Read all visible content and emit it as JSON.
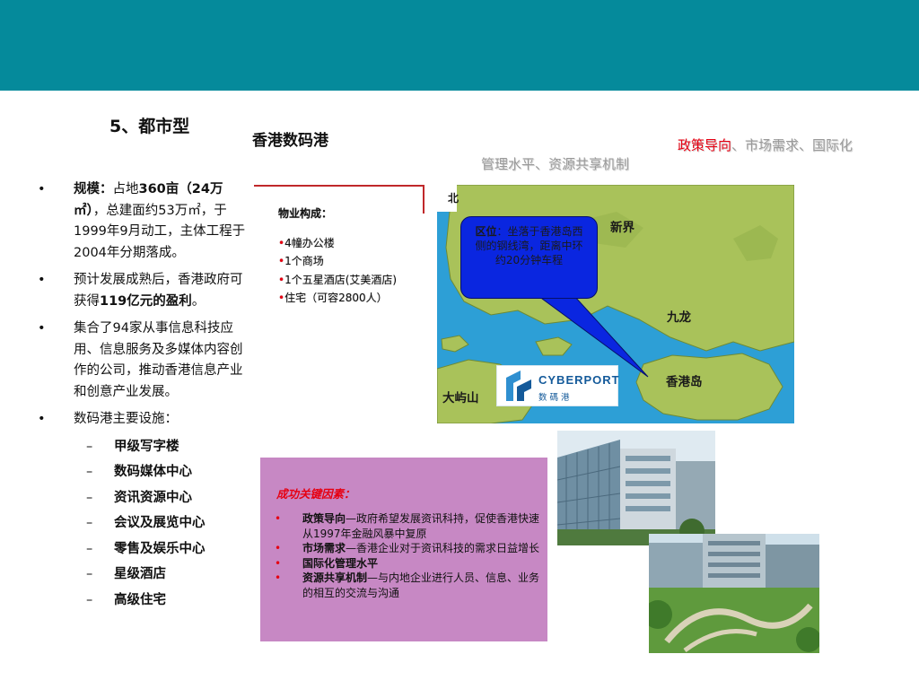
{
  "header": {
    "color": "#058a9b"
  },
  "section_title": "5、都市型",
  "project_name": "香港数码港",
  "factors_header": {
    "highlight": "政策导向",
    "rest_line1": "、市场需求、国际化",
    "line2": "管理水平、资源共享机制"
  },
  "bullets": {
    "b1": {
      "label": "规模：",
      "t1": "占地",
      "area": "360亩（24万㎡）",
      "t2": "，总建面约53万㎡，于1999年9月动工，主体工程于2004年分期落成。"
    },
    "b2": {
      "t1": "预计发展成熟后，香港政府可获得",
      "bold": "119亿元的盈利",
      "t2": "。"
    },
    "b3": {
      "text": "集合了94家从事信息科技应用、信息服务及多媒体内容创作的公司，推动香港信息产业和创意产业发展。"
    },
    "b4": {
      "text": "数码港主要设施："
    },
    "facilities": [
      "甲级写字楼",
      "数码媒体中心",
      "资讯资源中心",
      "会议及展览中心",
      "零售及娱乐中心",
      "星级酒店",
      "高级住宅"
    ]
  },
  "property": {
    "title": "物业构成：",
    "items": [
      "4幢办公楼",
      "1个商场",
      "1个五星酒店(艾美酒店)",
      "住宅（可容2800人）"
    ]
  },
  "map": {
    "north": "北",
    "labels": {
      "new_territories": "新界",
      "kowloon": "九龙",
      "hk_island": "香港岛",
      "lantau": "大屿山"
    },
    "callout": {
      "label": "区位",
      "text": "：坐落于香港岛西侧的钢线湾，距离中环约20分钟车程"
    },
    "logo": {
      "text": "CYBERPORT",
      "sub": "数 碼 港"
    }
  },
  "key_factors": {
    "title": "成功关键因素：",
    "items": [
      {
        "bold": "政策导向",
        "text": "—政府希望发展资讯科持，促使香港快速从1997年金融风暴中复原"
      },
      {
        "bold": "市场需求",
        "text": "—香港企业对于资讯科技的需求日益增长"
      },
      {
        "bold": "国际化管理水平",
        "text": ""
      },
      {
        "bold": "资源共享机制",
        "text": "—与内地企业进行人员、信息、业务的相互的交流与沟通"
      }
    ]
  },
  "photos": [
    "photo-building-glass",
    "photo-campus-garden"
  ]
}
